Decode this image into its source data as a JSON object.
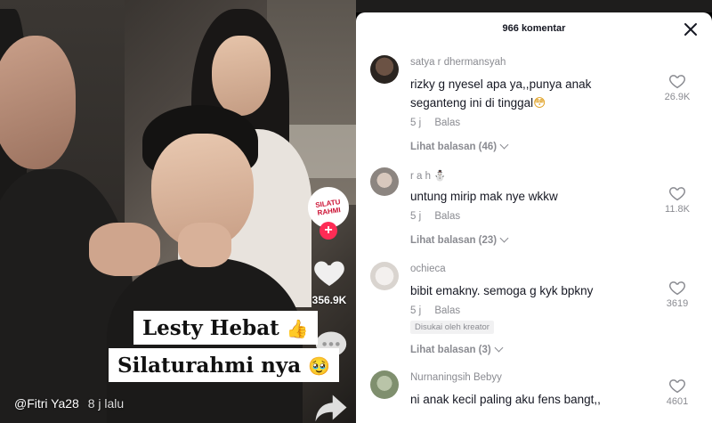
{
  "video": {
    "creator_handle": "@Fitri Ya28",
    "posted_time": "8 j lalu",
    "like_count": "356.9K",
    "caption_line1": "Lesty Hebat",
    "caption_line1_emoji": "👍",
    "caption_line2": "Silaturahmi nya",
    "caption_line2_emoji": "🥹",
    "creator_avatar_text": "SILATU RAHMI",
    "follow_symbol": "+"
  },
  "comments_sheet": {
    "title": "966 komentar",
    "comments": [
      {
        "user": "satya r dhermansyah",
        "text_line1": "rizky g nyesel apa ya,,punya anak",
        "text_line2": "seganteng ini di tinggal",
        "text_emoji": "😳",
        "time": "5 j",
        "reply_label": "Balas",
        "view_replies": "Lihat balasan (46)",
        "likes": "26.9K"
      },
      {
        "user": "r a h",
        "user_emoji": "⛄",
        "text_line1": "untung mirip mak nye wkkw",
        "time": "5 j",
        "reply_label": "Balas",
        "view_replies": "Lihat balasan (23)",
        "likes": "11.8K"
      },
      {
        "user": "ochieca",
        "text_line1": "bibit emakny. semoga g kyk bpkny",
        "time": "5 j",
        "reply_label": "Balas",
        "badge": "Disukai oleh kreator",
        "view_replies": "Lihat balasan (3)",
        "likes": "3619"
      },
      {
        "user": "Nurnaningsih Bebyy",
        "text_line1": "ni anak kecil paling aku fens bangt,,",
        "likes": "4601"
      }
    ]
  },
  "colors": {
    "accent": "#fe2c55",
    "muted_text": "#8a8b91",
    "primary_text": "#161823"
  }
}
